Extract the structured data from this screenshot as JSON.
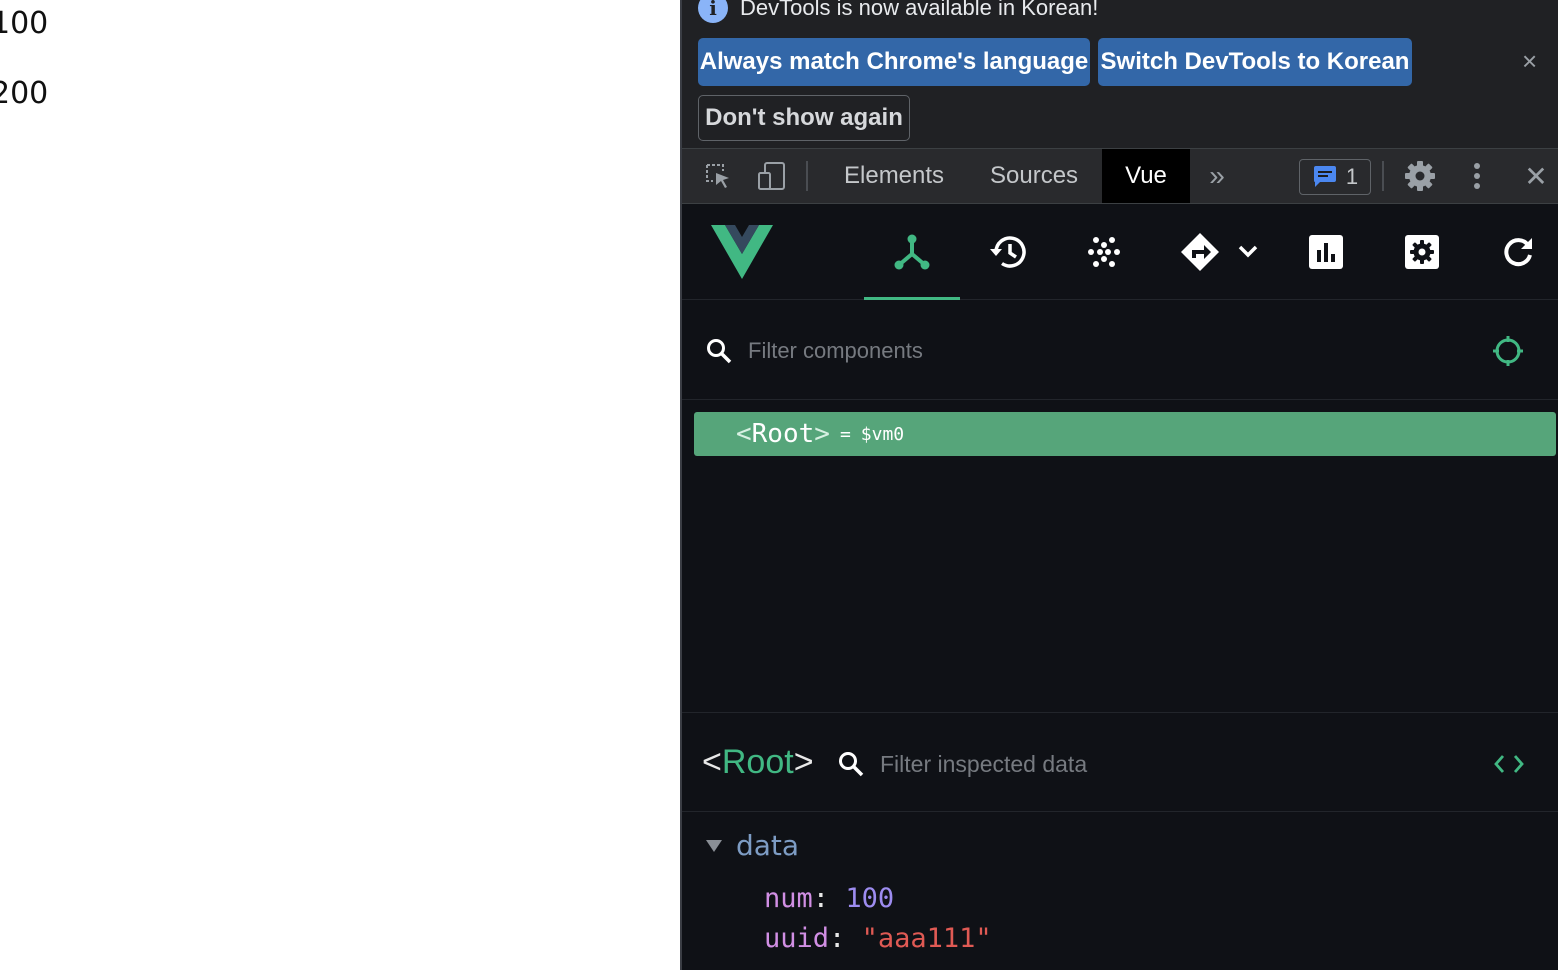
{
  "page": {
    "lines": [
      "100",
      "200"
    ]
  },
  "devtools": {
    "infobar": {
      "message": "DevTools is now available in Korean!",
      "info_glyph": "i",
      "buttons": {
        "match_language": "Always match Chrome's language",
        "switch_language": "Switch DevTools to Korean",
        "dont_show": "Don't show again"
      },
      "close_glyph": "×"
    },
    "tabs": [
      "Elements",
      "Sources",
      "Vue"
    ],
    "active_tab": "Vue",
    "more_tabs_glyph": "»",
    "issues_count": "1",
    "close_glyph": "✕",
    "vue": {
      "toolbar_icons": [
        "components-icon",
        "timeline-icon",
        "pinia-icon",
        "routes-icon",
        "performance-icon",
        "settings-icon",
        "refresh-icon"
      ],
      "active_tool": "components-icon",
      "filter_placeholder": "Filter components",
      "tree": {
        "open_bracket": "<",
        "name": "Root",
        "close_bracket": ">",
        "eq": "=",
        "vm": "$vm0"
      },
      "inspector": {
        "open_bracket": "<",
        "name": "Root",
        "close_bracket": ">",
        "filter_placeholder": "Filter inspected data",
        "section": "data",
        "colon": ":",
        "fields": [
          {
            "key": "num",
            "value": "100"
          },
          {
            "key": "uuid",
            "value": "\"aaa111\""
          }
        ]
      }
    }
  },
  "colors": {
    "vue_green": "#41b883",
    "selected_row": "#56a57a",
    "button_blue": "#3367a8",
    "panel_bg": "#0f1116",
    "key_color": "#d18fe4",
    "number_color": "#9d8cf0",
    "string_color": "#e05a54"
  }
}
